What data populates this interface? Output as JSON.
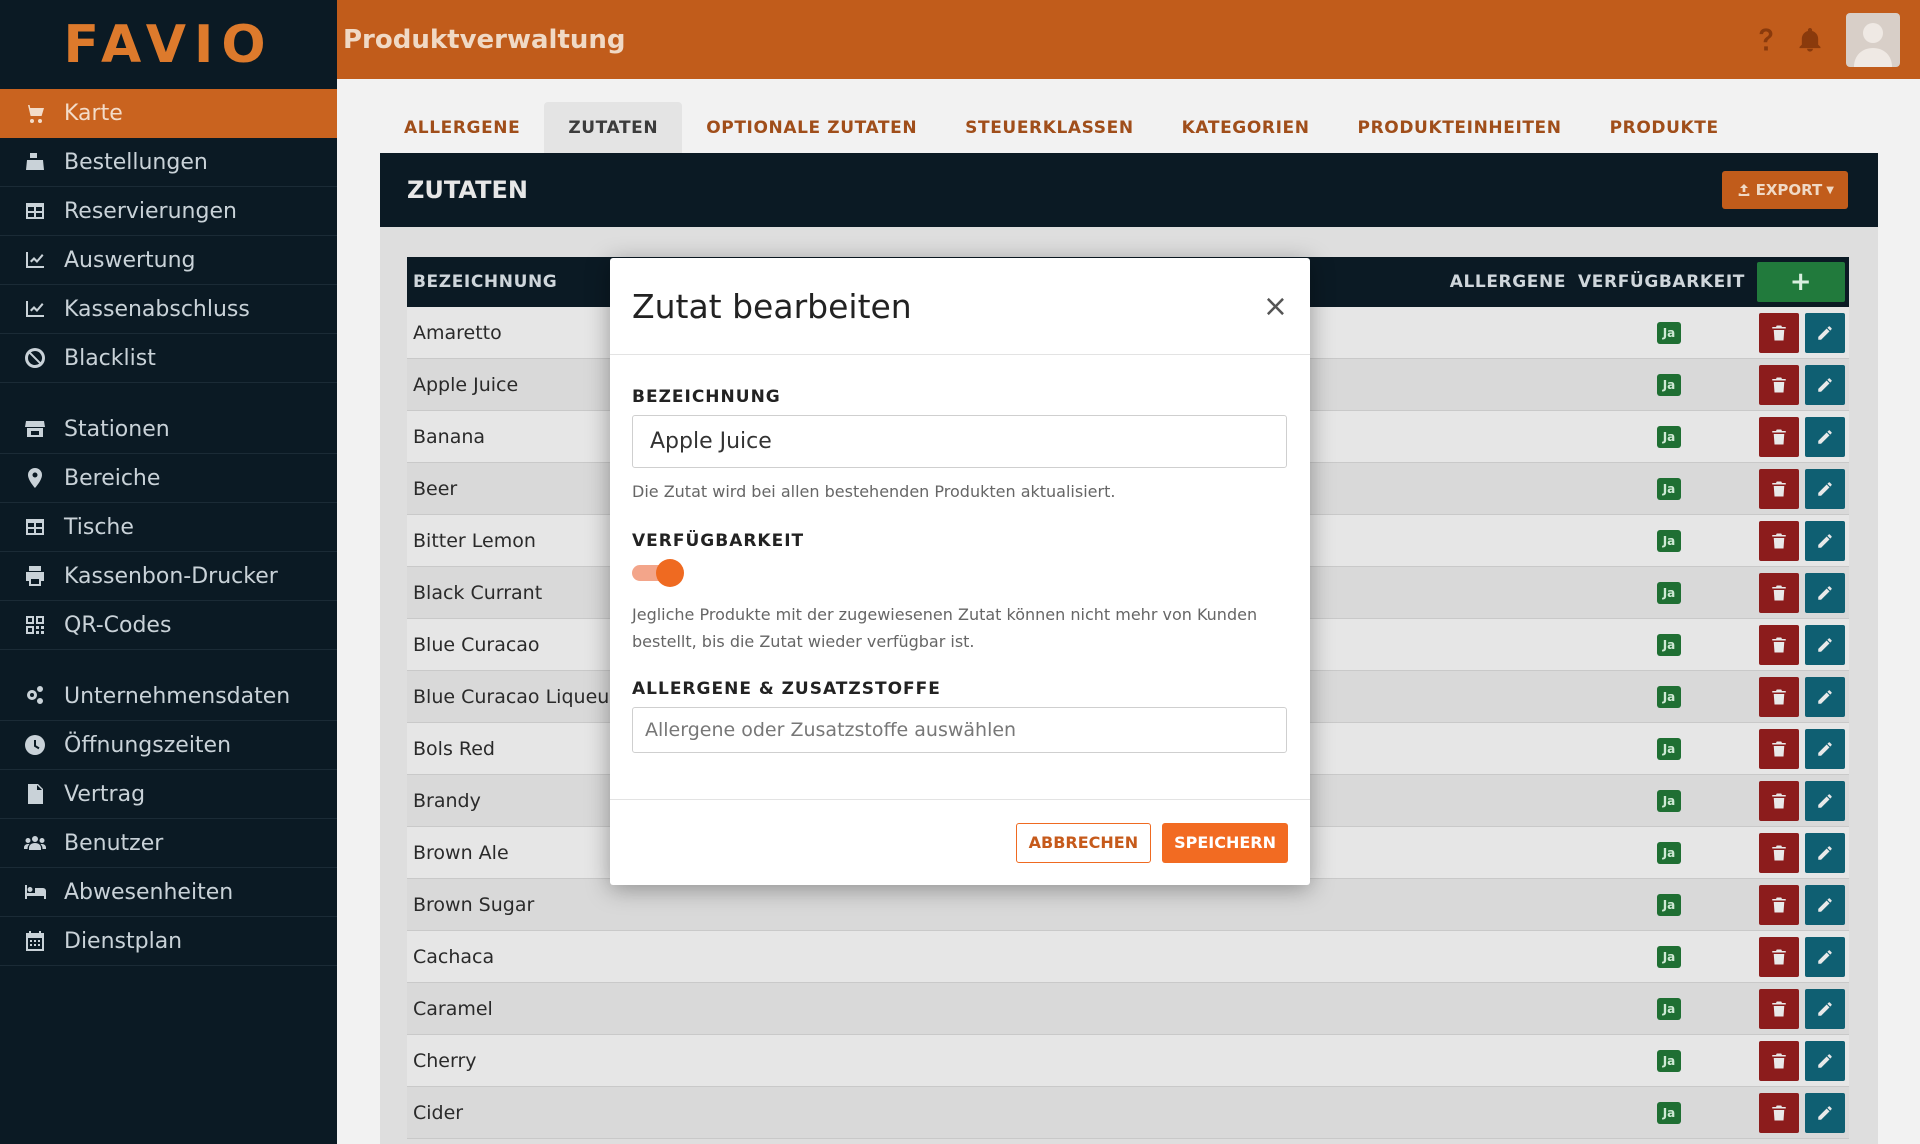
{
  "app": {
    "logo": "FAVIO",
    "page_title": "Produktverwaltung"
  },
  "sidebar": {
    "group1": [
      {
        "label": "Karte",
        "icon": "cart-icon",
        "active": true
      },
      {
        "label": "Bestellungen",
        "icon": "cash-register-icon"
      },
      {
        "label": "Reservierungen",
        "icon": "table-grid-icon"
      },
      {
        "label": "Auswertung",
        "icon": "chart-check-icon"
      },
      {
        "label": "Kassenabschluss",
        "icon": "chart-check-icon"
      },
      {
        "label": "Blacklist",
        "icon": "ban-icon"
      }
    ],
    "group2": [
      {
        "label": "Stationen",
        "icon": "store-icon"
      },
      {
        "label": "Bereiche",
        "icon": "map-pin-icon"
      },
      {
        "label": "Tische",
        "icon": "table-grid-icon"
      },
      {
        "label": "Kassenbon-Drucker",
        "icon": "printer-icon"
      },
      {
        "label": "QR-Codes",
        "icon": "qrcode-icon"
      }
    ],
    "group3": [
      {
        "label": "Unternehmensdaten",
        "icon": "gears-icon"
      },
      {
        "label": "Öffnungszeiten",
        "icon": "clock-icon"
      },
      {
        "label": "Vertrag",
        "icon": "document-icon"
      },
      {
        "label": "Benutzer",
        "icon": "users-icon"
      },
      {
        "label": "Abwesenheiten",
        "icon": "bed-icon"
      },
      {
        "label": "Dienstplan",
        "icon": "calendar-icon"
      }
    ]
  },
  "tabs": [
    "ALLERGENE",
    "ZUTATEN",
    "OPTIONALE ZUTATEN",
    "STEUERKLASSEN",
    "KATEGORIEN",
    "PRODUKTEINHEITEN",
    "PRODUKTE"
  ],
  "active_tab": "ZUTATEN",
  "card": {
    "title": "ZUTATEN",
    "export_label": "EXPORT"
  },
  "table": {
    "headers": {
      "name": "BEZEICHNUNG",
      "allergene": "ALLERGENE",
      "verfuegbarkeit": "VERFÜGBARKEIT",
      "add": "+"
    },
    "badge_label": "Ja",
    "rows": [
      "Amaretto",
      "Apple Juice",
      "Banana",
      "Beer",
      "Bitter Lemon",
      "Black Currant",
      "Blue Curacao",
      "Blue Curacao Liqueur",
      "Bols Red",
      "Brandy",
      "Brown Ale",
      "Brown Sugar",
      "Cachaca",
      "Caramel",
      "Cherry",
      "Cider"
    ]
  },
  "modal": {
    "title": "Zutat bearbeiten",
    "close": "×",
    "name_label": "BEZEICHNUNG",
    "name_value": "Apple Juice",
    "name_hint": "Die Zutat wird bei allen bestehenden Produkten aktualisiert.",
    "availability_label": "VERFÜGBARKEIT",
    "availability_on": true,
    "availability_hint": "Jegliche Produkte mit der zugewiesenen Zutat können nicht mehr von Kunden bestellt, bis die Zutat wieder verfügbar ist.",
    "allergens_label": "ALLERGENE & ZUSATZSTOFFE",
    "allergens_placeholder": "Allergene oder Zusatzstoffe auswählen",
    "cancel_label": "ABBRECHEN",
    "save_label": "SPEICHERN"
  },
  "colors": {
    "accent": "#c15c1b",
    "sidebar_bg": "#0b1a24",
    "available_badge": "#1f6f33",
    "delete": "#8c1c1c",
    "edit": "#0f5f72",
    "add": "#217a3c"
  }
}
